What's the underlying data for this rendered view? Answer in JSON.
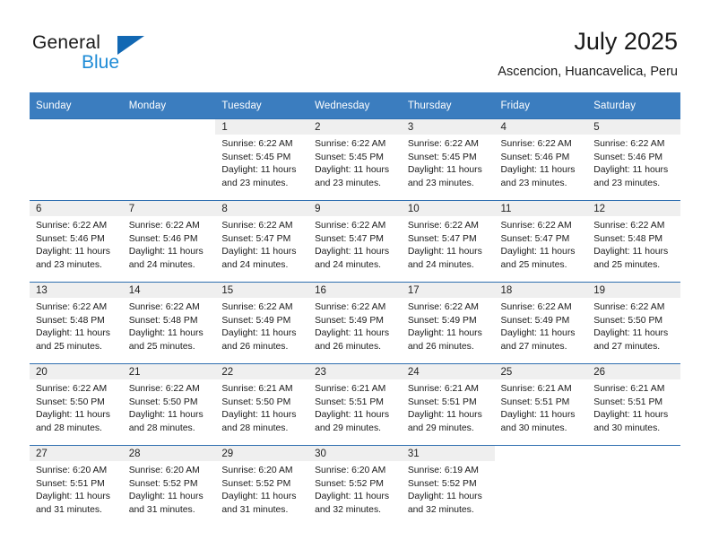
{
  "brand": {
    "name_part1": "General",
    "name_part2": "Blue",
    "logo_icon": "triangle-logo-icon",
    "accent_color": "#1268b3",
    "secondary_color": "#1e8bd6"
  },
  "header": {
    "title": "July 2025",
    "subtitle": "Ascencion, Huancavelica, Peru"
  },
  "calendar": {
    "header_bg": "#3b7dbf",
    "day_band_bg": "#efefef",
    "row_divider_color": "#2f6fb0",
    "weekday_headers": [
      "Sunday",
      "Monday",
      "Tuesday",
      "Wednesday",
      "Thursday",
      "Friday",
      "Saturday"
    ],
    "weeks": [
      [
        {
          "day": "",
          "empty": true,
          "sunrise": "",
          "sunset": "",
          "daylight_line1": "",
          "daylight_line2": ""
        },
        {
          "day": "",
          "empty": true,
          "sunrise": "",
          "sunset": "",
          "daylight_line1": "",
          "daylight_line2": ""
        },
        {
          "day": "1",
          "empty": false,
          "sunrise": "Sunrise: 6:22 AM",
          "sunset": "Sunset: 5:45 PM",
          "daylight_line1": "Daylight: 11 hours",
          "daylight_line2": "and 23 minutes."
        },
        {
          "day": "2",
          "empty": false,
          "sunrise": "Sunrise: 6:22 AM",
          "sunset": "Sunset: 5:45 PM",
          "daylight_line1": "Daylight: 11 hours",
          "daylight_line2": "and 23 minutes."
        },
        {
          "day": "3",
          "empty": false,
          "sunrise": "Sunrise: 6:22 AM",
          "sunset": "Sunset: 5:45 PM",
          "daylight_line1": "Daylight: 11 hours",
          "daylight_line2": "and 23 minutes."
        },
        {
          "day": "4",
          "empty": false,
          "sunrise": "Sunrise: 6:22 AM",
          "sunset": "Sunset: 5:46 PM",
          "daylight_line1": "Daylight: 11 hours",
          "daylight_line2": "and 23 minutes."
        },
        {
          "day": "5",
          "empty": false,
          "sunrise": "Sunrise: 6:22 AM",
          "sunset": "Sunset: 5:46 PM",
          "daylight_line1": "Daylight: 11 hours",
          "daylight_line2": "and 23 minutes."
        }
      ],
      [
        {
          "day": "6",
          "empty": false,
          "sunrise": "Sunrise: 6:22 AM",
          "sunset": "Sunset: 5:46 PM",
          "daylight_line1": "Daylight: 11 hours",
          "daylight_line2": "and 23 minutes."
        },
        {
          "day": "7",
          "empty": false,
          "sunrise": "Sunrise: 6:22 AM",
          "sunset": "Sunset: 5:46 PM",
          "daylight_line1": "Daylight: 11 hours",
          "daylight_line2": "and 24 minutes."
        },
        {
          "day": "8",
          "empty": false,
          "sunrise": "Sunrise: 6:22 AM",
          "sunset": "Sunset: 5:47 PM",
          "daylight_line1": "Daylight: 11 hours",
          "daylight_line2": "and 24 minutes."
        },
        {
          "day": "9",
          "empty": false,
          "sunrise": "Sunrise: 6:22 AM",
          "sunset": "Sunset: 5:47 PM",
          "daylight_line1": "Daylight: 11 hours",
          "daylight_line2": "and 24 minutes."
        },
        {
          "day": "10",
          "empty": false,
          "sunrise": "Sunrise: 6:22 AM",
          "sunset": "Sunset: 5:47 PM",
          "daylight_line1": "Daylight: 11 hours",
          "daylight_line2": "and 24 minutes."
        },
        {
          "day": "11",
          "empty": false,
          "sunrise": "Sunrise: 6:22 AM",
          "sunset": "Sunset: 5:47 PM",
          "daylight_line1": "Daylight: 11 hours",
          "daylight_line2": "and 25 minutes."
        },
        {
          "day": "12",
          "empty": false,
          "sunrise": "Sunrise: 6:22 AM",
          "sunset": "Sunset: 5:48 PM",
          "daylight_line1": "Daylight: 11 hours",
          "daylight_line2": "and 25 minutes."
        }
      ],
      [
        {
          "day": "13",
          "empty": false,
          "sunrise": "Sunrise: 6:22 AM",
          "sunset": "Sunset: 5:48 PM",
          "daylight_line1": "Daylight: 11 hours",
          "daylight_line2": "and 25 minutes."
        },
        {
          "day": "14",
          "empty": false,
          "sunrise": "Sunrise: 6:22 AM",
          "sunset": "Sunset: 5:48 PM",
          "daylight_line1": "Daylight: 11 hours",
          "daylight_line2": "and 25 minutes."
        },
        {
          "day": "15",
          "empty": false,
          "sunrise": "Sunrise: 6:22 AM",
          "sunset": "Sunset: 5:49 PM",
          "daylight_line1": "Daylight: 11 hours",
          "daylight_line2": "and 26 minutes."
        },
        {
          "day": "16",
          "empty": false,
          "sunrise": "Sunrise: 6:22 AM",
          "sunset": "Sunset: 5:49 PM",
          "daylight_line1": "Daylight: 11 hours",
          "daylight_line2": "and 26 minutes."
        },
        {
          "day": "17",
          "empty": false,
          "sunrise": "Sunrise: 6:22 AM",
          "sunset": "Sunset: 5:49 PM",
          "daylight_line1": "Daylight: 11 hours",
          "daylight_line2": "and 26 minutes."
        },
        {
          "day": "18",
          "empty": false,
          "sunrise": "Sunrise: 6:22 AM",
          "sunset": "Sunset: 5:49 PM",
          "daylight_line1": "Daylight: 11 hours",
          "daylight_line2": "and 27 minutes."
        },
        {
          "day": "19",
          "empty": false,
          "sunrise": "Sunrise: 6:22 AM",
          "sunset": "Sunset: 5:50 PM",
          "daylight_line1": "Daylight: 11 hours",
          "daylight_line2": "and 27 minutes."
        }
      ],
      [
        {
          "day": "20",
          "empty": false,
          "sunrise": "Sunrise: 6:22 AM",
          "sunset": "Sunset: 5:50 PM",
          "daylight_line1": "Daylight: 11 hours",
          "daylight_line2": "and 28 minutes."
        },
        {
          "day": "21",
          "empty": false,
          "sunrise": "Sunrise: 6:22 AM",
          "sunset": "Sunset: 5:50 PM",
          "daylight_line1": "Daylight: 11 hours",
          "daylight_line2": "and 28 minutes."
        },
        {
          "day": "22",
          "empty": false,
          "sunrise": "Sunrise: 6:21 AM",
          "sunset": "Sunset: 5:50 PM",
          "daylight_line1": "Daylight: 11 hours",
          "daylight_line2": "and 28 minutes."
        },
        {
          "day": "23",
          "empty": false,
          "sunrise": "Sunrise: 6:21 AM",
          "sunset": "Sunset: 5:51 PM",
          "daylight_line1": "Daylight: 11 hours",
          "daylight_line2": "and 29 minutes."
        },
        {
          "day": "24",
          "empty": false,
          "sunrise": "Sunrise: 6:21 AM",
          "sunset": "Sunset: 5:51 PM",
          "daylight_line1": "Daylight: 11 hours",
          "daylight_line2": "and 29 minutes."
        },
        {
          "day": "25",
          "empty": false,
          "sunrise": "Sunrise: 6:21 AM",
          "sunset": "Sunset: 5:51 PM",
          "daylight_line1": "Daylight: 11 hours",
          "daylight_line2": "and 30 minutes."
        },
        {
          "day": "26",
          "empty": false,
          "sunrise": "Sunrise: 6:21 AM",
          "sunset": "Sunset: 5:51 PM",
          "daylight_line1": "Daylight: 11 hours",
          "daylight_line2": "and 30 minutes."
        }
      ],
      [
        {
          "day": "27",
          "empty": false,
          "sunrise": "Sunrise: 6:20 AM",
          "sunset": "Sunset: 5:51 PM",
          "daylight_line1": "Daylight: 11 hours",
          "daylight_line2": "and 31 minutes."
        },
        {
          "day": "28",
          "empty": false,
          "sunrise": "Sunrise: 6:20 AM",
          "sunset": "Sunset: 5:52 PM",
          "daylight_line1": "Daylight: 11 hours",
          "daylight_line2": "and 31 minutes."
        },
        {
          "day": "29",
          "empty": false,
          "sunrise": "Sunrise: 6:20 AM",
          "sunset": "Sunset: 5:52 PM",
          "daylight_line1": "Daylight: 11 hours",
          "daylight_line2": "and 31 minutes."
        },
        {
          "day": "30",
          "empty": false,
          "sunrise": "Sunrise: 6:20 AM",
          "sunset": "Sunset: 5:52 PM",
          "daylight_line1": "Daylight: 11 hours",
          "daylight_line2": "and 32 minutes."
        },
        {
          "day": "31",
          "empty": false,
          "sunrise": "Sunrise: 6:19 AM",
          "sunset": "Sunset: 5:52 PM",
          "daylight_line1": "Daylight: 11 hours",
          "daylight_line2": "and 32 minutes."
        },
        {
          "day": "",
          "empty": true,
          "sunrise": "",
          "sunset": "",
          "daylight_line1": "",
          "daylight_line2": ""
        },
        {
          "day": "",
          "empty": true,
          "sunrise": "",
          "sunset": "",
          "daylight_line1": "",
          "daylight_line2": ""
        }
      ]
    ]
  }
}
